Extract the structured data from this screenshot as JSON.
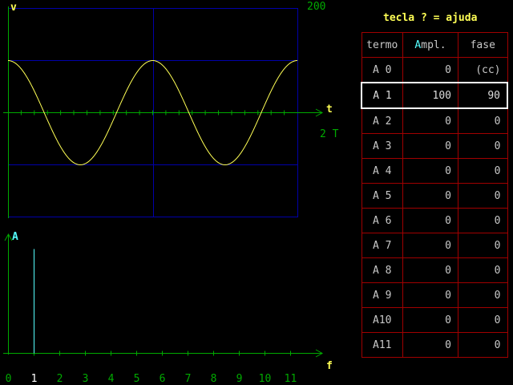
{
  "help_hint": "tecla ? = ajuda",
  "colors": {
    "axis": "#00aa00",
    "grid": "#0000aa",
    "wave": "#ffff55",
    "cyan": "#55ffff",
    "table_border": "#a00000",
    "selected_border": "#ffffff",
    "yellow_label": "#ffff55",
    "green_label": "#00aa00"
  },
  "time_plot": {
    "y_label": "v",
    "x_label": "t",
    "scale_value": "200",
    "span_label": "2 T"
  },
  "spectrum_plot": {
    "y_label": "A",
    "x_label": "f",
    "x_ticks": [
      "0",
      "1",
      "2",
      "3",
      "4",
      "5",
      "6",
      "7",
      "8",
      "9",
      "10",
      "11"
    ],
    "highlight_index": 1
  },
  "table": {
    "headers": {
      "term": "termo",
      "ampl_prefix": "A",
      "ampl_rest": "mpl.",
      "phase": "fase"
    },
    "selected_index": 1,
    "rows": [
      {
        "term": "A 0",
        "ampl": "0",
        "phase": "(cc)"
      },
      {
        "term": "A 1",
        "ampl": "100",
        "phase": "90"
      },
      {
        "term": "A 2",
        "ampl": "0",
        "phase": "0"
      },
      {
        "term": "A 3",
        "ampl": "0",
        "phase": "0"
      },
      {
        "term": "A 4",
        "ampl": "0",
        "phase": "0"
      },
      {
        "term": "A 5",
        "ampl": "0",
        "phase": "0"
      },
      {
        "term": "A 6",
        "ampl": "0",
        "phase": "0"
      },
      {
        "term": "A 7",
        "ampl": "0",
        "phase": "0"
      },
      {
        "term": "A 8",
        "ampl": "0",
        "phase": "0"
      },
      {
        "term": "A 9",
        "ampl": "0",
        "phase": "0"
      },
      {
        "term": "A10",
        "ampl": "0",
        "phase": "0"
      },
      {
        "term": "A11",
        "ampl": "0",
        "phase": "0"
      }
    ]
  },
  "chart_data": [
    {
      "type": "line",
      "xlabel": "t",
      "ylabel": "v",
      "x_span_periods": 2,
      "ylim": [
        -200,
        200
      ],
      "series": [
        {
          "function": "sine",
          "amplitude": 100,
          "phase_deg": 90,
          "harmonic": 1
        }
      ]
    },
    {
      "type": "bar",
      "xlabel": "f",
      "ylabel": "A",
      "categories": [
        "0",
        "1",
        "2",
        "3",
        "4",
        "5",
        "6",
        "7",
        "8",
        "9",
        "10",
        "11"
      ],
      "values": [
        0,
        100,
        0,
        0,
        0,
        0,
        0,
        0,
        0,
        0,
        0,
        0
      ]
    }
  ]
}
